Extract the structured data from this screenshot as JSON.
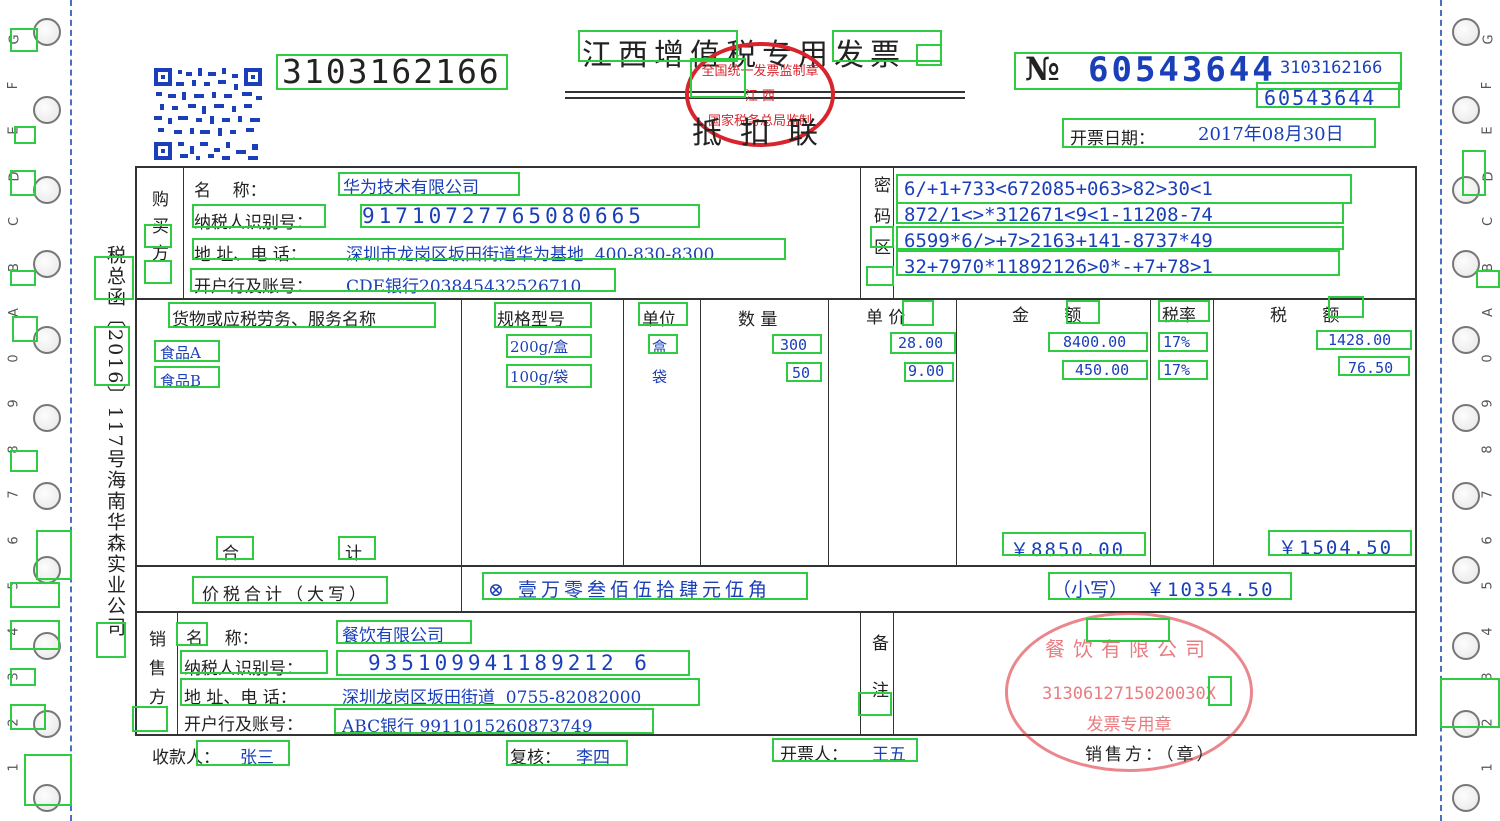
{
  "header": {
    "title": "江西增值税专用发票",
    "invoice_code": "3103162166",
    "no_symbol": "№",
    "invoice_number": "60543644",
    "small_code": "3103162166",
    "small_number": "60543644",
    "copy_type": "抵扣联",
    "issue_date_label": "开票日期：",
    "issue_date": "2017年08月30日",
    "stamp_text": "全国统一发票监制章",
    "stamp_region": "江 西",
    "stamp_bottom": "国家税务总局监制"
  },
  "side_text": {
    "left_vertical": "税总函〔2016〕117号海南华森实业公司"
  },
  "buyer": {
    "section_label": "购买方",
    "name_label": "名    称：",
    "name": "华为技术有限公司",
    "tax_id_label": "纳税人识别号：",
    "tax_id": "91710727765080665",
    "address_label": "地 址、电 话：",
    "address": "深圳市龙岗区坂田街道华为基地  400-830-8300",
    "bank_label": "开户行及账号：",
    "bank": "CDE银行203845432526710"
  },
  "cipher": {
    "label": "密码区",
    "lines": [
      "6/+1+733<672085+063>82>30<1",
      "872/1<>*312671<9<1-11208-74",
      "6599*6/>+7>2163+141-8737*49",
      "32+7970*11892126>0*-+7+78>1"
    ]
  },
  "columns": {
    "item": "货物或应税劳务、服务名称",
    "spec": "规格型号",
    "unit": "单位",
    "qty": "数 量",
    "price": "单 价",
    "amount": "金 额",
    "rate": "税率",
    "tax": "税 额"
  },
  "items": [
    {
      "name": "食品A",
      "spec": "200g/盒",
      "unit": "盒",
      "qty": "300",
      "price": "28.00",
      "amount": "8400.00",
      "rate": "17%",
      "tax": "1428.00"
    },
    {
      "name": "食品B",
      "spec": "100g/袋",
      "unit": "袋",
      "qty": "50",
      "price": "9.00",
      "amount": "450.00",
      "rate": "17%",
      "tax": "76.50"
    }
  ],
  "totals": {
    "label_he": "合",
    "label_ji": "计",
    "amount": "￥8850.00",
    "tax": "￥1504.50",
    "total_caps_label": "价税合计（大写）",
    "total_caps": "⊗ 壹万零叁佰伍拾肆元伍角",
    "total_small_label": "（小写）",
    "total_small": "￥10354.50"
  },
  "seller": {
    "section_label": "销售方",
    "name_label": "名    称：",
    "name": "餐饮有限公司",
    "tax_id_label": "纳税人识别号：",
    "tax_id": "935109941189212 6",
    "address_label": "地 址、电 话：",
    "address": "深圳龙岗区坂田街道  0755-82082000",
    "bank_label": "开户行及账号：",
    "bank": "ABC银行 9911015260873749"
  },
  "remarks": {
    "label": "备注",
    "stamp_text": "餐饮有限公司",
    "stamp_number": "3130612715020030X",
    "stamp_bottom": "发票专用章"
  },
  "footer": {
    "payee_label": "收款人：",
    "payee": "张三",
    "reviewer_label": "复核：",
    "reviewer": "李四",
    "issuer_label": "开票人：",
    "issuer": "王五",
    "seller_seal": "销售方：（章）"
  },
  "margin_left": [
    "G",
    "F",
    "E",
    "D",
    "C",
    "B",
    "A",
    "0",
    "9",
    "8",
    "7",
    "6",
    "5",
    "4",
    "3",
    "2",
    "1"
  ],
  "margin_right": [
    "G",
    "F",
    "E",
    "D",
    "C",
    "B",
    "A",
    "0",
    "9",
    "8",
    "7",
    "6",
    "5",
    "4",
    "3",
    "2",
    "1"
  ],
  "colors": {
    "stamp_red": "#d8252d",
    "blue_ink": "#1a3fb8",
    "highlight_box": "#2ecc40"
  }
}
